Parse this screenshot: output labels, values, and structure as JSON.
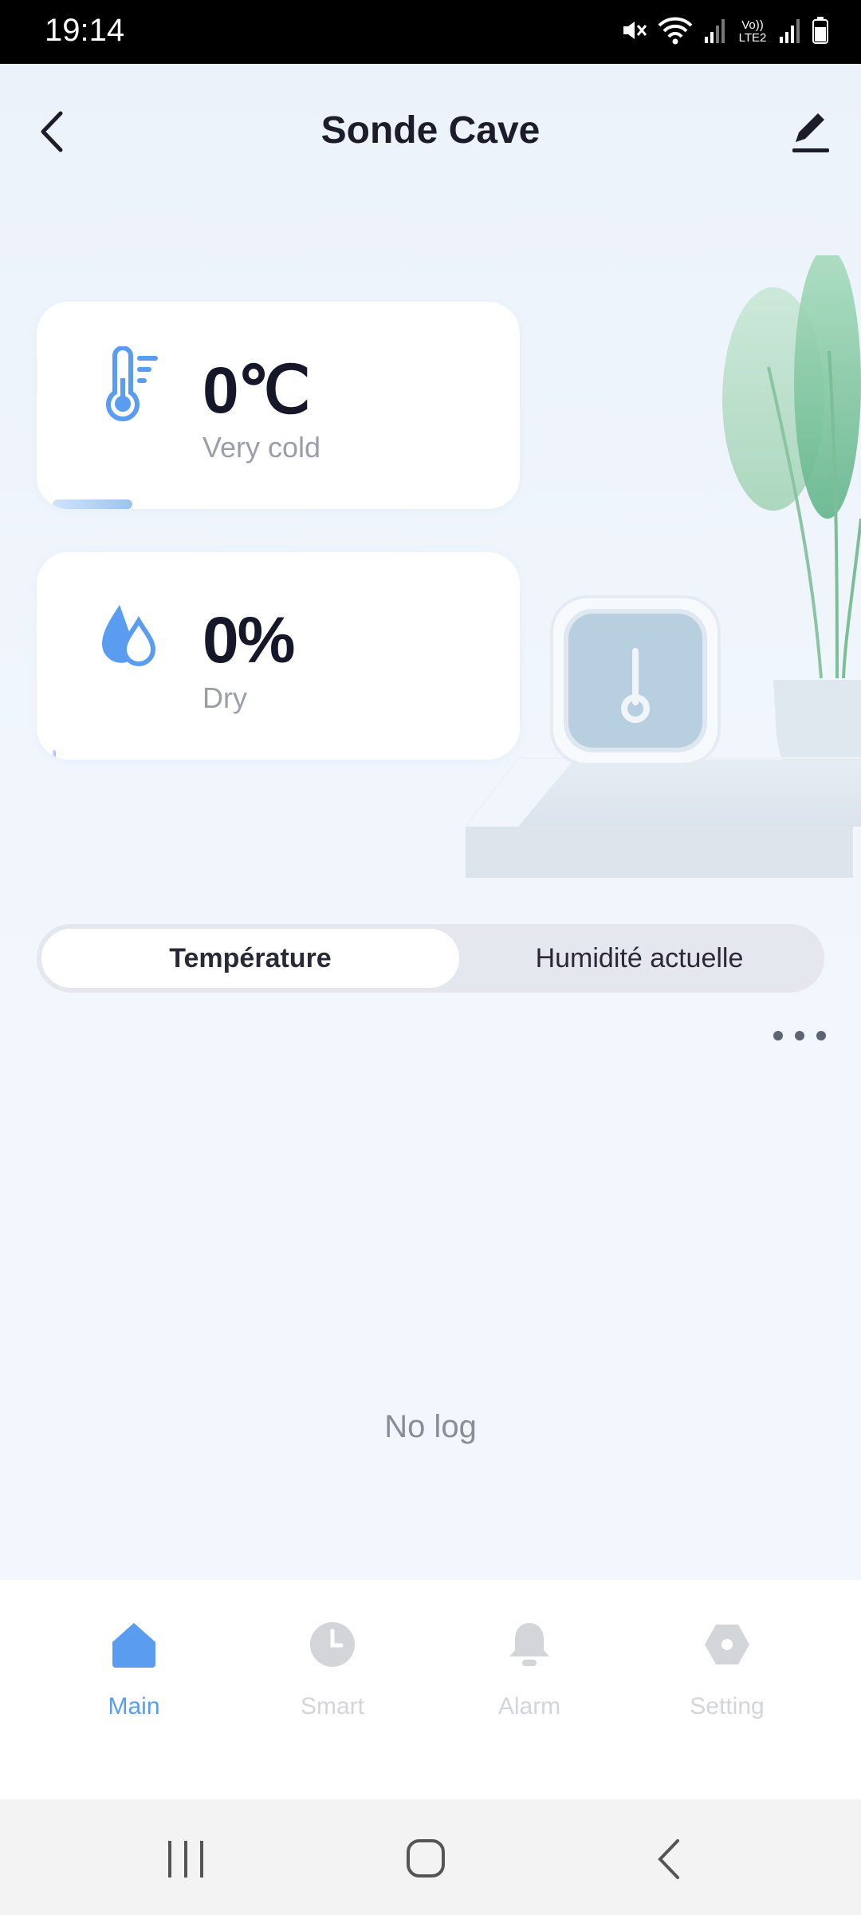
{
  "status_bar": {
    "time": "19:14",
    "icons": [
      "mute-icon",
      "wifi-icon",
      "signal-icon",
      "volte-lte2-icon",
      "signal-icon",
      "battery-icon"
    ],
    "volte_text": "Vo)) LTE2"
  },
  "header": {
    "title": "Sonde Cave",
    "back_icon": "chevron-left-icon",
    "edit_icon": "pencil-icon"
  },
  "temperature_card": {
    "icon": "thermometer-icon",
    "value": "0℃",
    "label": "Very cold"
  },
  "humidity_card": {
    "icon": "water-drops-icon",
    "value": "0%",
    "label": "Dry"
  },
  "tabs": [
    {
      "label": "Température",
      "active": true
    },
    {
      "label": "Humidité actuelle",
      "active": false
    }
  ],
  "empty_state": "No log",
  "bottom_nav": [
    {
      "label": "Main",
      "icon": "home-icon",
      "active": true
    },
    {
      "label": "Smart",
      "icon": "clock-icon",
      "active": false
    },
    {
      "label": "Alarm",
      "icon": "bell-icon",
      "active": false
    },
    {
      "label": "Setting",
      "icon": "hexagon-gear-icon",
      "active": false
    }
  ],
  "colors": {
    "accent": "#5a9df0",
    "background": "#eef3fa",
    "text_primary": "#17172a",
    "text_secondary": "#9b9ea8",
    "inactive_nav": "#d3d5d9"
  }
}
